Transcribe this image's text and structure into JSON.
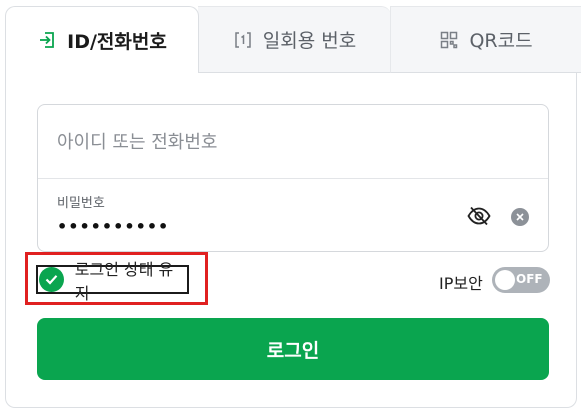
{
  "tabs": [
    {
      "label": "ID/전화번호",
      "icon": "login-enter-icon",
      "active": true
    },
    {
      "label": "일회용 번호",
      "icon": "one-time-number-icon",
      "active": false
    },
    {
      "label": "QR코드",
      "icon": "qr-code-icon",
      "active": false
    }
  ],
  "form": {
    "id_placeholder": "아이디 또는 전화번호",
    "id_value": "",
    "password_label": "비밀번호",
    "password_value": "••••••••••"
  },
  "options": {
    "keep_login_label": "로그인 상태 유지",
    "keep_login_checked": true,
    "ip_security_label": "IP보안",
    "ip_security_state": "OFF"
  },
  "login_button_label": "로그인",
  "colors": {
    "accent": "#0aa54f",
    "toggle_off": "#aeb3b9",
    "highlight": "#e02020"
  }
}
